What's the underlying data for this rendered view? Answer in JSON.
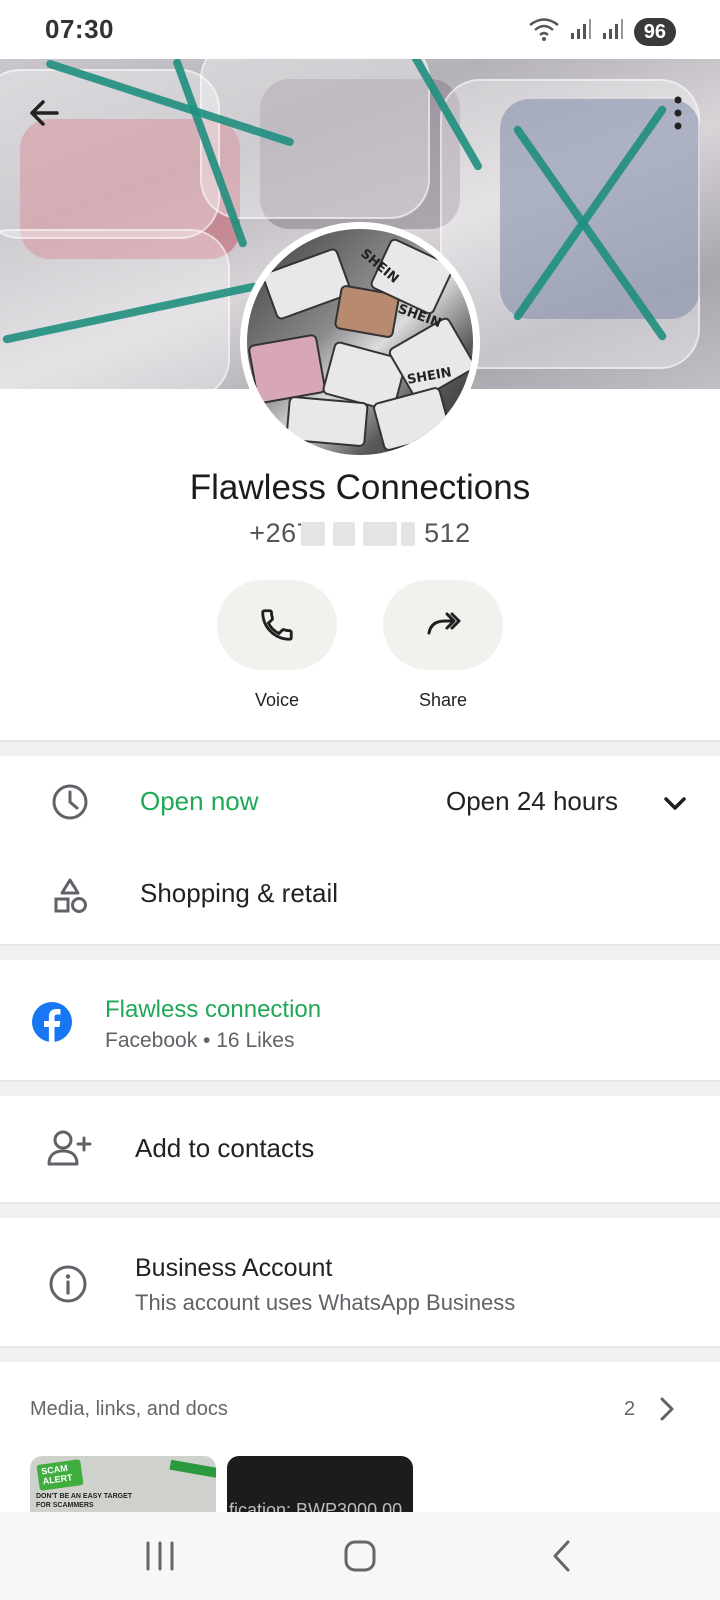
{
  "status_bar": {
    "time": "07:30",
    "battery": "96"
  },
  "profile": {
    "name": "Flawless Connections",
    "phone_prefix": "+267",
    "phone_suffix": "512",
    "avatar_labels": [
      "SHEIN",
      "SHEIN",
      "SHEIN"
    ]
  },
  "actions": [
    {
      "label": "Voice",
      "icon": "phone-icon"
    },
    {
      "label": "Share",
      "icon": "forward-arrow-icon"
    }
  ],
  "business_hours": {
    "status": "Open now",
    "hours": "Open 24 hours",
    "status_color": "#1fa855"
  },
  "category": {
    "label": "Shopping & retail"
  },
  "facebook": {
    "title": "Flawless connection",
    "subtitle": "Facebook • 16 Likes"
  },
  "add_contacts": {
    "label": "Add to contacts"
  },
  "business_account": {
    "title": "Business Account",
    "subtitle": "This account uses WhatsApp Business"
  },
  "media": {
    "title": "Media, links, and docs",
    "count": "2",
    "thumb1_badge": "SCAM ALERT",
    "thumb1_caption": "DON'T BE AN EASY TARGET FOR SCAMMERS",
    "thumb2_text": "fication: BWP3000.00"
  }
}
